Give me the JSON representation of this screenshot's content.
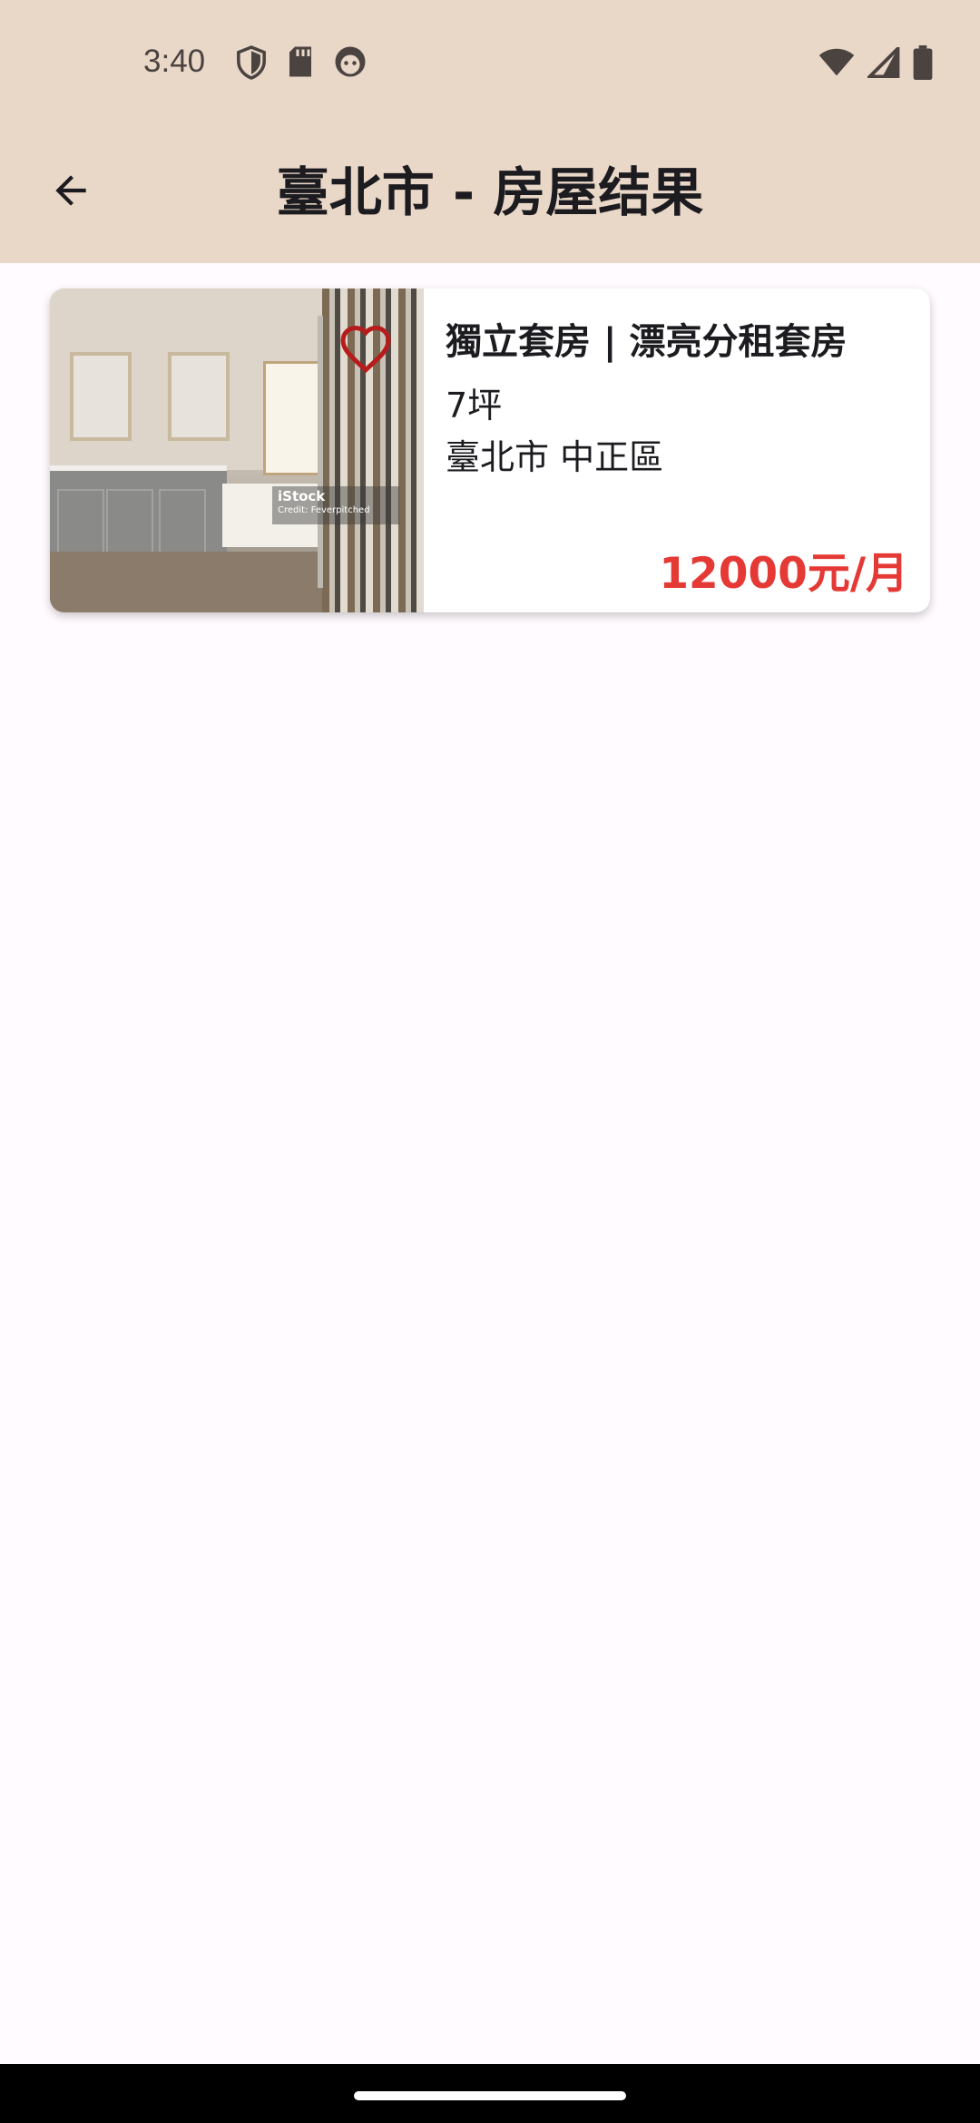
{
  "status_bar": {
    "time": "3:40",
    "left_icons": [
      "shield-icon",
      "sd-card-icon",
      "face-icon"
    ],
    "right_icons": [
      "wifi-icon",
      "signal-icon",
      "battery-icon"
    ]
  },
  "app_bar": {
    "title": "臺北市 - 房屋结果",
    "back_icon": "arrow-back-icon"
  },
  "listings": [
    {
      "title": "獨立套房 | 漂亮分租套房",
      "size": "7坪",
      "location": "臺北市 中正區",
      "price": "12000元/月",
      "image_watermark": {
        "brand": "iStock",
        "credit": "Credit: Feverpitched"
      },
      "favorite_icon": "heart-outline-icon",
      "favorite": false
    }
  ],
  "colors": {
    "app_bar_bg": "#e9d7c8",
    "page_bg": "#fffbfe",
    "price": "#e53935",
    "favorite": "#b71c1c"
  }
}
